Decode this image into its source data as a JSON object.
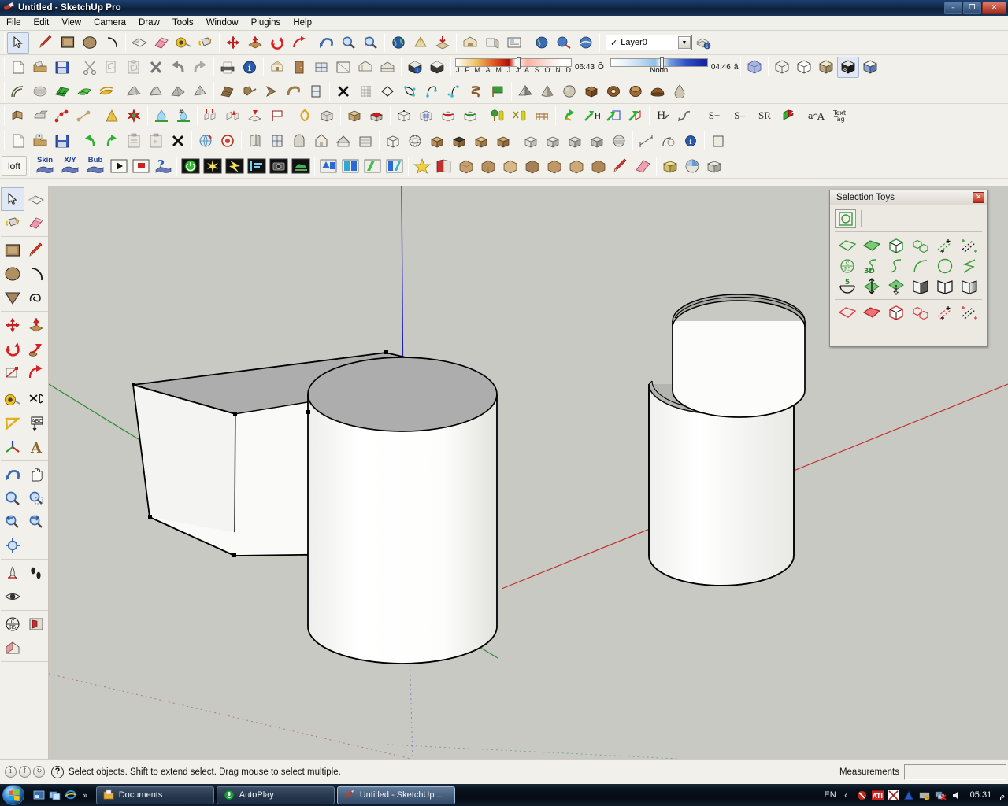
{
  "window": {
    "title": "Untitled - SketchUp Pro",
    "app_icon": "sketchup-logo-icon",
    "buttons": {
      "minimize": "–",
      "maximize": "❐",
      "close": "✕"
    }
  },
  "menubar": {
    "items": [
      "File",
      "Edit",
      "View",
      "Camera",
      "Draw",
      "Tools",
      "Window",
      "Plugins",
      "Help"
    ]
  },
  "toolbars": {
    "row1": {
      "groups": [
        {
          "tools": [
            {
              "name": "select-tool",
              "icon": "arrow-cursor-icon",
              "selected": true
            }
          ]
        },
        {
          "tools": [
            {
              "name": "line-tool",
              "icon": "pencil-icon"
            },
            {
              "name": "rectangle-tool",
              "icon": "square-icon"
            },
            {
              "name": "circle-tool",
              "icon": "circle-icon"
            },
            {
              "name": "arc-tool",
              "icon": "arc-icon"
            }
          ]
        },
        {
          "tools": [
            {
              "name": "pushpull-tool",
              "icon": "pushpull-icon"
            },
            {
              "name": "eraser-tool",
              "icon": "eraser-icon"
            },
            {
              "name": "tape-measure-tool",
              "icon": "tape-measure-icon"
            },
            {
              "name": "paint-bucket-tool",
              "icon": "paint-bucket-icon"
            }
          ]
        },
        {
          "tools": [
            {
              "name": "move-tool",
              "icon": "move-arrows-icon"
            },
            {
              "name": "scale-tool",
              "icon": "scale-icon"
            },
            {
              "name": "rotate-tool",
              "icon": "rotate-icon"
            },
            {
              "name": "follow-me-tool",
              "icon": "followme-icon"
            }
          ]
        },
        {
          "tools": [
            {
              "name": "orbit-tool",
              "icon": "orbit-icon"
            },
            {
              "name": "zoom-tool",
              "icon": "magnifier-icon"
            },
            {
              "name": "zoom-extents-tool",
              "icon": "zoom-extents-icon"
            }
          ]
        },
        {
          "tools": [
            {
              "name": "google-earth-tool",
              "icon": "globe-icon"
            },
            {
              "name": "add-location-tool",
              "icon": "location-icon"
            },
            {
              "name": "get-models-tool",
              "icon": "download-model-icon"
            }
          ]
        },
        {
          "tools": [
            {
              "name": "warehouse-tool",
              "icon": "warehouse-icon"
            },
            {
              "name": "share-model-tool",
              "icon": "share-icon"
            },
            {
              "name": "layout-tool",
              "icon": "layout-icon"
            }
          ]
        },
        {
          "tools": [
            {
              "name": "photo-match-tool",
              "icon": "photo-globe-icon"
            },
            {
              "name": "place-model-tool",
              "icon": "place-model-icon"
            },
            {
              "name": "toggle-terrain-tool",
              "icon": "terrain-icon"
            }
          ]
        }
      ],
      "layer": {
        "name": "Layer0",
        "checked": "✓",
        "arrow": "▼",
        "manager_icon": "layer-manager-icon"
      }
    },
    "row2": {
      "file_tools": [
        "new-document-icon",
        "open-folder-icon",
        "save-disk-icon"
      ],
      "edit_tools": [
        "scissors-cut-icon",
        "copy-icon",
        "paste-icon",
        "delete-x-icon",
        "undo-arrow-icon",
        "redo-arrow-icon"
      ],
      "print_tools": [
        "print-icon",
        "model-info-icon"
      ],
      "component_tools": [
        "make-component-icon",
        "component-door-icon",
        "component-window-icon",
        "section-plane-icon",
        "section-display-icon",
        "section-cut-icon"
      ],
      "shadow_tools": [
        "shadow-info-icon",
        "shadow-toggle-icon"
      ],
      "shadows": {
        "month_labels": [
          "J",
          "F",
          "M",
          "A",
          "M",
          "J",
          "J",
          "A",
          "S",
          "O",
          "N",
          "D"
        ],
        "dark_time": "06:43",
        "noon_label": "Noon",
        "light_time": "04:46",
        "date_glyph": "Õ",
        "time_glyph": "â"
      },
      "styles": [
        "xray-view-icon",
        "wireframe-view-icon",
        "hidden-line-view-icon",
        "shaded-view-icon",
        "shaded-texture-view-icon",
        "monochrome-view-icon"
      ]
    },
    "row3": {
      "curve_tools": [
        "arc-plugin-icon",
        "contour-mesh-icon",
        "green-grid-mesh-icon",
        "green-quad-mesh-icon",
        "gold-drape-icon"
      ],
      "surface_tools": [
        "soap-skin-1-icon",
        "soap-skin-2-icon",
        "soap-skin-3-icon",
        "soap-skin-4-icon"
      ],
      "extrude_tools": [
        "extrude-edge-icon",
        "lathe-icon",
        "profile-builder-icon",
        "curve-sweep-icon",
        "window-frame-icon"
      ],
      "edit_tools": [
        "delete-cross-icon",
        "grid-mesh-icon",
        "diamond-face-icon",
        "bezier-loop-icon",
        "bezier-arc-icon",
        "bezier-curve-icon",
        "helix-icon",
        "flag-face-icon"
      ],
      "solid_tools": [
        "pyramid-solid-icon",
        "cone-solid-icon",
        "sphere-solid-icon",
        "box-solid-icon",
        "torus-solid-icon",
        "cylinder-solid-icon",
        "dome-solid-icon",
        "teardrop-solid-icon"
      ]
    },
    "row4": {
      "group_a": [
        "joint-pushpull-icon",
        "round-corner-icon",
        "bezier-point-red-icon",
        "bezier-point-tan-icon"
      ],
      "group_b": [
        "cone-taper-icon",
        "starburst-icon"
      ],
      "group_c": [
        "water-drop-icon",
        "water-hash-icon"
      ],
      "group_d": [
        "extrude-up-icon",
        "extrude-tool-icon",
        "extrude-down-icon",
        "flag-white-icon"
      ],
      "group_e": [
        "loop-gold-icon",
        "cube-mesh-icon"
      ],
      "group_f": [
        "box-tan-icon",
        "box-red-icon"
      ],
      "group_g": [
        "mesh-wire-icon",
        "mesh-blue-icon",
        "mesh-red-icon",
        "mesh-green-icon"
      ],
      "group_h": [
        "tree-tool-icon",
        "scissors-tree-icon",
        "fence-icon"
      ],
      "group_i": [
        "arrow-twist-icon",
        "arrow-h-icon",
        "arrow-frame-icon",
        "arrow-box-icon"
      ],
      "group_j": [
        "h-arrow-icon",
        "swoosh-arrow-icon"
      ],
      "group_k": [
        "s-plus-label",
        "s-minus-label",
        "s-r-label",
        "green-cube-icon"
      ],
      "group_l": [
        "font-change-icon",
        "text-tag-icon"
      ],
      "labels": {
        "s_plus": "S+",
        "s_minus": "S–",
        "s_r": "SR",
        "text_tag": "Text\nTag",
        "font": "a→A"
      }
    },
    "row5": {
      "file": [
        "new-page-icon",
        "open-box-icon",
        "save-blue-icon"
      ],
      "edit": [
        "rotate-left-icon",
        "rotate-right-icon",
        "clipboard-icon",
        "paste-clip-icon",
        "delete-x2-icon"
      ],
      "tools": [
        "globe-spin-icon",
        "circle-red-icon"
      ],
      "arch": [
        "door-frame-icon",
        "window-panel-icon",
        "arch-door-icon",
        "house-panel-icon",
        "roof-panel-icon",
        "wall-panel-icon"
      ],
      "shapes": [
        "wire-cube-icon",
        "wire-sphere-icon",
        "brown-cube-1-icon",
        "brown-cube-2-icon",
        "brown-cube-3-icon",
        "brown-cube-4-icon",
        "gray-cube-1-icon",
        "gray-cube-2-icon",
        "gray-cube-3-icon",
        "gray-cube-4-icon",
        "mesh-roll-icon"
      ],
      "dim": [
        "dimension-icon",
        "fillet-icon",
        "info-circle-icon",
        "frame-icon"
      ]
    },
    "row6": {
      "loft_label": "loft",
      "plugins": [
        {
          "label": "Skin",
          "name": "skin-button"
        },
        {
          "label": "X/Y",
          "name": "xy-button"
        },
        {
          "label": "Bub",
          "name": "bub-button"
        }
      ],
      "controls": [
        "play-button-icon",
        "stop-button-icon",
        "help-question-icon"
      ],
      "extras": [
        "power-green-icon",
        "sparkle-icon",
        "lightning-icon",
        "align-icon",
        "camera-icon",
        "fog-icon"
      ],
      "colors": [
        "blue-swatch-icon",
        "cyan-swatch-icon",
        "green-swatch-icon",
        "teal-swatch-icon"
      ],
      "misc": [
        "star-icon",
        "book-icon",
        "wood-1-icon",
        "wood-2-icon",
        "wood-3-icon",
        "wood-4-icon",
        "wood-5-icon",
        "wood-6-icon",
        "wood-7-icon",
        "pen-icon",
        "eraser2-icon"
      ],
      "right": [
        "cube-yellow-icon",
        "globe-pie-icon",
        "cube-gray-icon"
      ]
    }
  },
  "left_toolbar": {
    "groups": [
      {
        "tools": [
          {
            "name": "select-tool",
            "icon": "arrow-cursor-icon",
            "selected": true
          },
          {
            "name": "make-component-tool",
            "icon": "component-icon"
          },
          {
            "name": "paint-bucket-tool",
            "icon": "paint-bucket-icon"
          },
          {
            "name": "eraser-tool",
            "icon": "eraser-icon"
          }
        ]
      },
      {
        "tools": [
          {
            "name": "rectangle-tool",
            "icon": "square-icon"
          },
          {
            "name": "line-tool",
            "icon": "pencil-icon"
          },
          {
            "name": "circle-tool",
            "icon": "circle-icon"
          },
          {
            "name": "arc-tool",
            "icon": "arc-icon"
          },
          {
            "name": "polygon-tool",
            "icon": "triangle-icon"
          },
          {
            "name": "freehand-tool",
            "icon": "freehand-icon"
          }
        ]
      },
      {
        "tools": [
          {
            "name": "move-tool",
            "icon": "move-arrows-icon"
          },
          {
            "name": "pushpull-tool",
            "icon": "pushpull-icon"
          },
          {
            "name": "rotate-tool",
            "icon": "rotate-icon"
          },
          {
            "name": "follow-me-tool",
            "icon": "followme-icon"
          },
          {
            "name": "scale-tool",
            "icon": "scale-icon"
          },
          {
            "name": "offset-tool",
            "icon": "offset-icon"
          }
        ]
      },
      {
        "tools": [
          {
            "name": "tape-measure-tool",
            "icon": "tape-measure-icon"
          },
          {
            "name": "dimension-tool",
            "icon": "dimension-icon"
          },
          {
            "name": "protractor-tool",
            "icon": "protractor-icon"
          },
          {
            "name": "text-tool",
            "icon": "abc-text-icon"
          },
          {
            "name": "axes-tool",
            "icon": "axes-icon"
          },
          {
            "name": "3d-text-tool",
            "icon": "3d-text-icon"
          }
        ]
      },
      {
        "tools": [
          {
            "name": "orbit-tool",
            "icon": "orbit-icon"
          },
          {
            "name": "pan-tool",
            "icon": "hand-icon"
          },
          {
            "name": "zoom-tool",
            "icon": "magnifier-icon"
          },
          {
            "name": "zoom-window-tool",
            "icon": "zoom-window-icon"
          },
          {
            "name": "previous-view-tool",
            "icon": "zoom-prev-icon"
          },
          {
            "name": "next-view-tool",
            "icon": "zoom-next-icon"
          },
          {
            "name": "zoom-extents-tool",
            "icon": "zoom-extents-icon"
          }
        ]
      },
      {
        "tools": [
          {
            "name": "position-camera-tool",
            "icon": "position-camera-icon"
          },
          {
            "name": "walk-tool",
            "icon": "footprints-icon"
          },
          {
            "name": "look-around-tool",
            "icon": "eye-icon"
          }
        ]
      },
      {
        "tools": [
          {
            "name": "section-plane-tool",
            "icon": "section-plane-icon"
          },
          {
            "name": "section-display-tool",
            "icon": "section-display-icon"
          },
          {
            "name": "section-cut-tool",
            "icon": "section-cut-icon"
          }
        ]
      }
    ]
  },
  "viewport": {
    "background": "#c9c9c4",
    "axes": {
      "red": "#c03030",
      "green": "#207020",
      "blue": "#2020a0"
    },
    "models": [
      {
        "name": "rectangular-box",
        "type": "box"
      },
      {
        "name": "cylinder",
        "type": "cylinder"
      },
      {
        "name": "curved-shell-upper",
        "type": "curved-surface"
      },
      {
        "name": "curved-shell-lower",
        "type": "curved-surface"
      }
    ]
  },
  "selection_toys": {
    "title": "Selection Toys",
    "close_label": "✕",
    "top_tool": "select-circle-icon",
    "green_row1": [
      "green-face-outline-icon",
      "green-face-filled-icon",
      "green-cube-icon",
      "green-multi-cube-icon",
      "green-dashed-plus-icon",
      "green-dashed-cross-icon"
    ],
    "green_row2": [
      "c-r5-circle-icon",
      "3d-curve-icon",
      "s-curve-icon",
      "arc-curve-icon",
      "circle-outline-icon",
      "zigzag-icon"
    ],
    "green_row3": [
      "arc-5-icon",
      "green-updown-icon",
      "green-diamond-arrow-icon",
      "book-dark-icon",
      "book-outline-icon",
      "book-gradient-icon"
    ],
    "red_row1": [
      "red-face-outline-icon",
      "red-face-filled-icon",
      "red-cube-icon",
      "red-multi-cube-icon",
      "red-dashed-plus-icon",
      "red-dashed-cross-icon"
    ]
  },
  "statusbar": {
    "left_icons": [
      "info-circle-icon",
      "up-arrow-circle-icon",
      "refresh-circle-icon"
    ],
    "help_icon": "question-mark-icon",
    "message": "Select objects. Shift to extend select. Drag mouse to select multiple.",
    "measurements_label": "Measurements",
    "measurements_value": ""
  },
  "taskbar": {
    "start_button": "windows-orb-icon",
    "quick_launch": [
      "show-desktop-icon",
      "switch-windows-icon",
      "internet-explorer-icon"
    ],
    "overflow": "»",
    "tasks": [
      {
        "label": "Documents",
        "icon": "folder-icon",
        "active": false
      },
      {
        "label": "AutoPlay",
        "icon": "autoplay-icon",
        "active": false
      },
      {
        "label": "Untitled - SketchUp ...",
        "icon": "sketchup-logo-icon",
        "active": true
      }
    ],
    "tray": {
      "language": "EN",
      "chevron": "‹",
      "icons": [
        "shield-block-icon",
        "ati-icon",
        "graphics-icon",
        "antivirus-icon",
        "keyboard-icon",
        "network-error-icon",
        "volume-icon"
      ],
      "clock": "05:31",
      "meridiem": "م"
    }
  }
}
